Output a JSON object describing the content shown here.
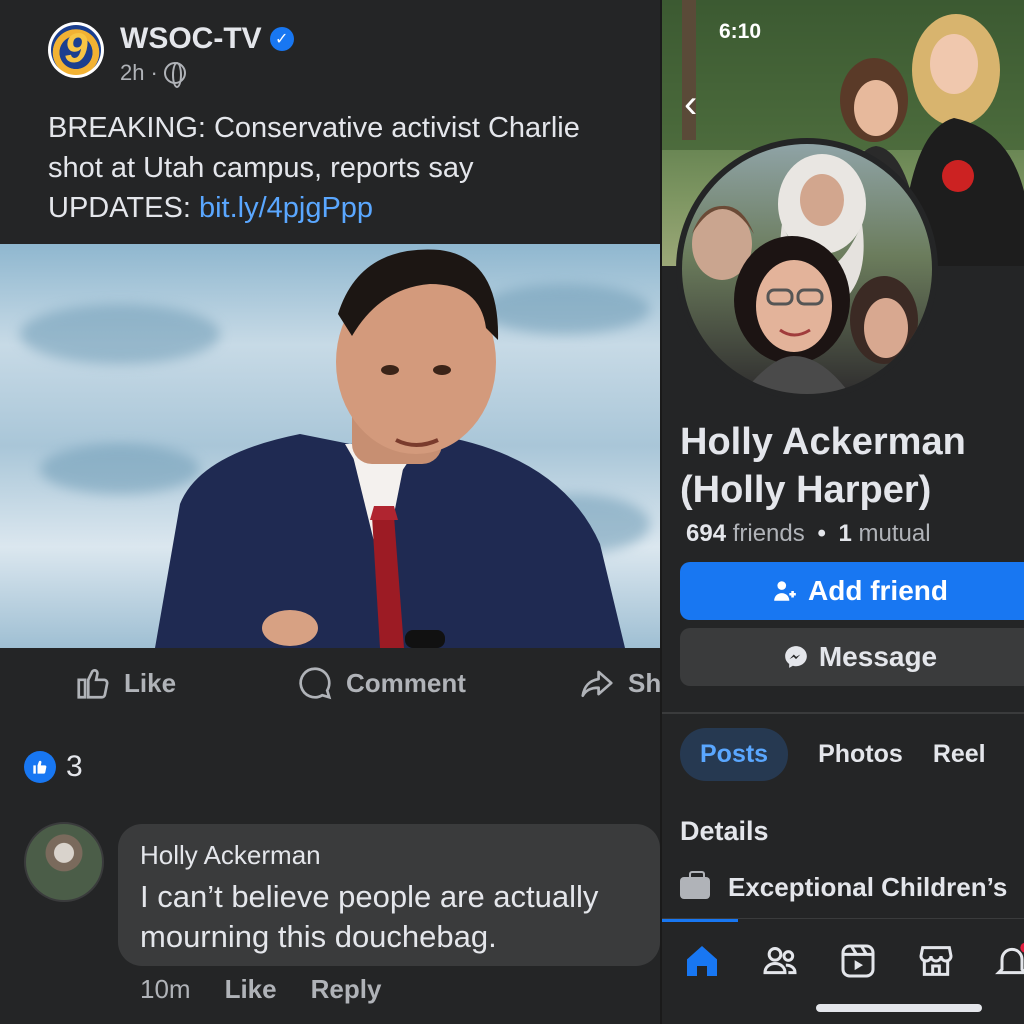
{
  "post": {
    "page_name": "WSOC-TV",
    "time": "2h",
    "separator": "·",
    "text_line1": "BREAKING: Conservative activist Charlie",
    "text_line2": "shot at Utah campus, reports say",
    "text_line3_prefix": "UPDATES: ",
    "link": "bit.ly/4pjgPpp",
    "logo_glyph": "9"
  },
  "actions": {
    "like": "Like",
    "comment": "Comment",
    "share": "Sh"
  },
  "reactions": {
    "count": "3"
  },
  "comment": {
    "author": "Holly Ackerman",
    "text_line1": "I can’t believe people are actually",
    "text_line2": "mourning this douchebag.",
    "time": "10m",
    "like": "Like",
    "reply": "Reply"
  },
  "profile": {
    "status_time": "6:10",
    "back_glyph": "‹",
    "name_line1": "Holly Ackerman",
    "name_line2": "(Holly Harper)",
    "friends_count": "694",
    "friends_label": "friends",
    "bullet": "•",
    "mutual_count": "1",
    "mutual_label": "mutual",
    "add_friend": "Add friend",
    "message": "Message",
    "tabs": [
      "Posts",
      "Photos",
      "Reel"
    ],
    "details_heading": "Details",
    "detail_work": "Exceptional Children’s"
  },
  "colors": {
    "background": "#242526",
    "accent": "#1877f2",
    "link": "#5aa7ff",
    "bubble": "#3a3b3c"
  }
}
